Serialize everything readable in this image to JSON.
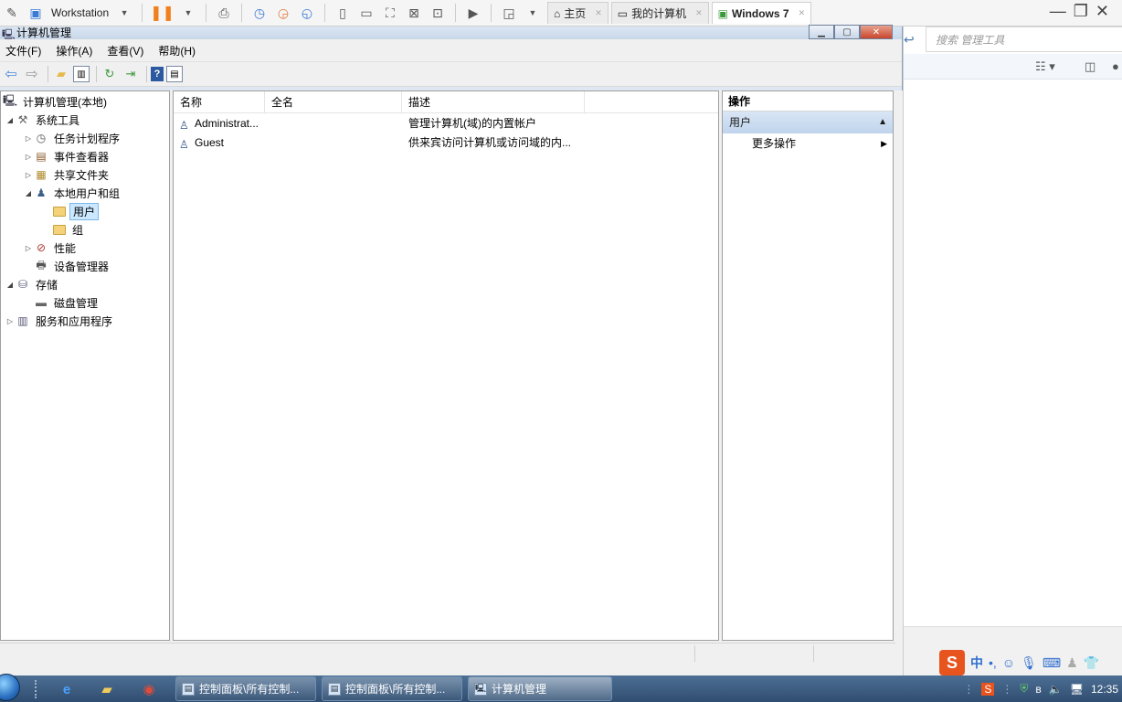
{
  "vmware": {
    "product": "Workstation",
    "tabs": [
      {
        "label": "主页",
        "icon": "home-icon"
      },
      {
        "label": "我的计算机",
        "icon": "computer-icon"
      },
      {
        "label": "Windows 7",
        "icon": "vm-icon"
      }
    ]
  },
  "window": {
    "title": "计算机管理"
  },
  "menu": [
    "文件(F)",
    "操作(A)",
    "查看(V)",
    "帮助(H)"
  ],
  "tree": {
    "items": [
      {
        "label": "计算机管理(本地)",
        "icon": "computer-management-icon",
        "expander": ""
      },
      {
        "label": "系统工具",
        "icon": "tools-icon",
        "expander": "◢"
      },
      {
        "label": "任务计划程序",
        "icon": "clock-icon",
        "expander": "▷"
      },
      {
        "label": "事件查看器",
        "icon": "event-viewer-icon",
        "expander": "▷"
      },
      {
        "label": "共享文件夹",
        "icon": "shared-folder-icon",
        "expander": "▷"
      },
      {
        "label": "本地用户和组",
        "icon": "users-group-icon",
        "expander": "◢"
      },
      {
        "label": "用户",
        "icon": "folder-icon",
        "expander": ""
      },
      {
        "label": "组",
        "icon": "folder-icon",
        "expander": ""
      },
      {
        "label": "性能",
        "icon": "performance-icon",
        "expander": "▷"
      },
      {
        "label": "设备管理器",
        "icon": "device-manager-icon",
        "expander": ""
      },
      {
        "label": "存储",
        "icon": "storage-icon",
        "expander": "◢"
      },
      {
        "label": "磁盘管理",
        "icon": "disk-icon",
        "expander": ""
      },
      {
        "label": "服务和应用程序",
        "icon": "services-icon",
        "expander": "▷"
      }
    ],
    "selected": "用户"
  },
  "list": {
    "columns": [
      "名称",
      "全名",
      "描述"
    ],
    "rows": [
      {
        "name": "Administrat...",
        "fullname": "",
        "description": "管理计算机(域)的内置帐户"
      },
      {
        "name": "Guest",
        "fullname": "",
        "description": "供来宾访问计算机或访问域的内..."
      }
    ]
  },
  "actions": {
    "title": "操作",
    "section": "用户",
    "links": [
      "更多操作"
    ]
  },
  "host": {
    "search_placeholder": "搜索 管理工具"
  },
  "taskbar": {
    "tasks": [
      {
        "label": "控制面板\\所有控制..."
      },
      {
        "label": "控制面板\\所有控制..."
      },
      {
        "label": "计算机管理"
      }
    ],
    "clock": "12:35"
  },
  "ime": {
    "logo": "S",
    "mode": "中",
    "punct": "•,"
  },
  "colors": {
    "accent": "#2f6fd0",
    "selection": "#cce8ff",
    "taskbar": "#2f4d70"
  }
}
